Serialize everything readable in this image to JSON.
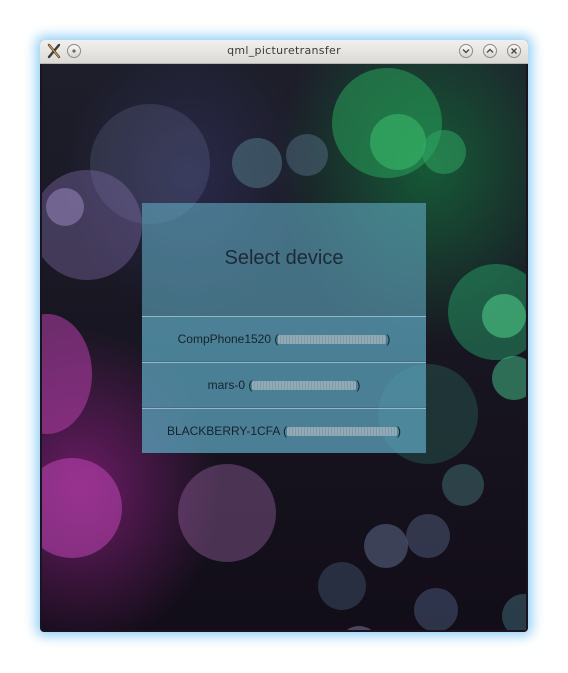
{
  "window": {
    "title": "qml_picturetransfer",
    "icons": {
      "app": "app-x-icon",
      "menu": "window-menu-icon",
      "minimize": "minimize-icon",
      "maximize": "maximize-icon",
      "close": "close-icon"
    }
  },
  "dialog": {
    "title": "Select device",
    "devices": [
      {
        "name": "CompPhone1520",
        "open": "(",
        "close": ")"
      },
      {
        "name": "mars-0",
        "open": "(",
        "close": ")"
      },
      {
        "name": "BLACKBERRY-1CFA",
        "open": "(",
        "close": ")"
      }
    ]
  },
  "colors": {
    "panel": "#60a6be",
    "glow": "#6ebef0"
  }
}
